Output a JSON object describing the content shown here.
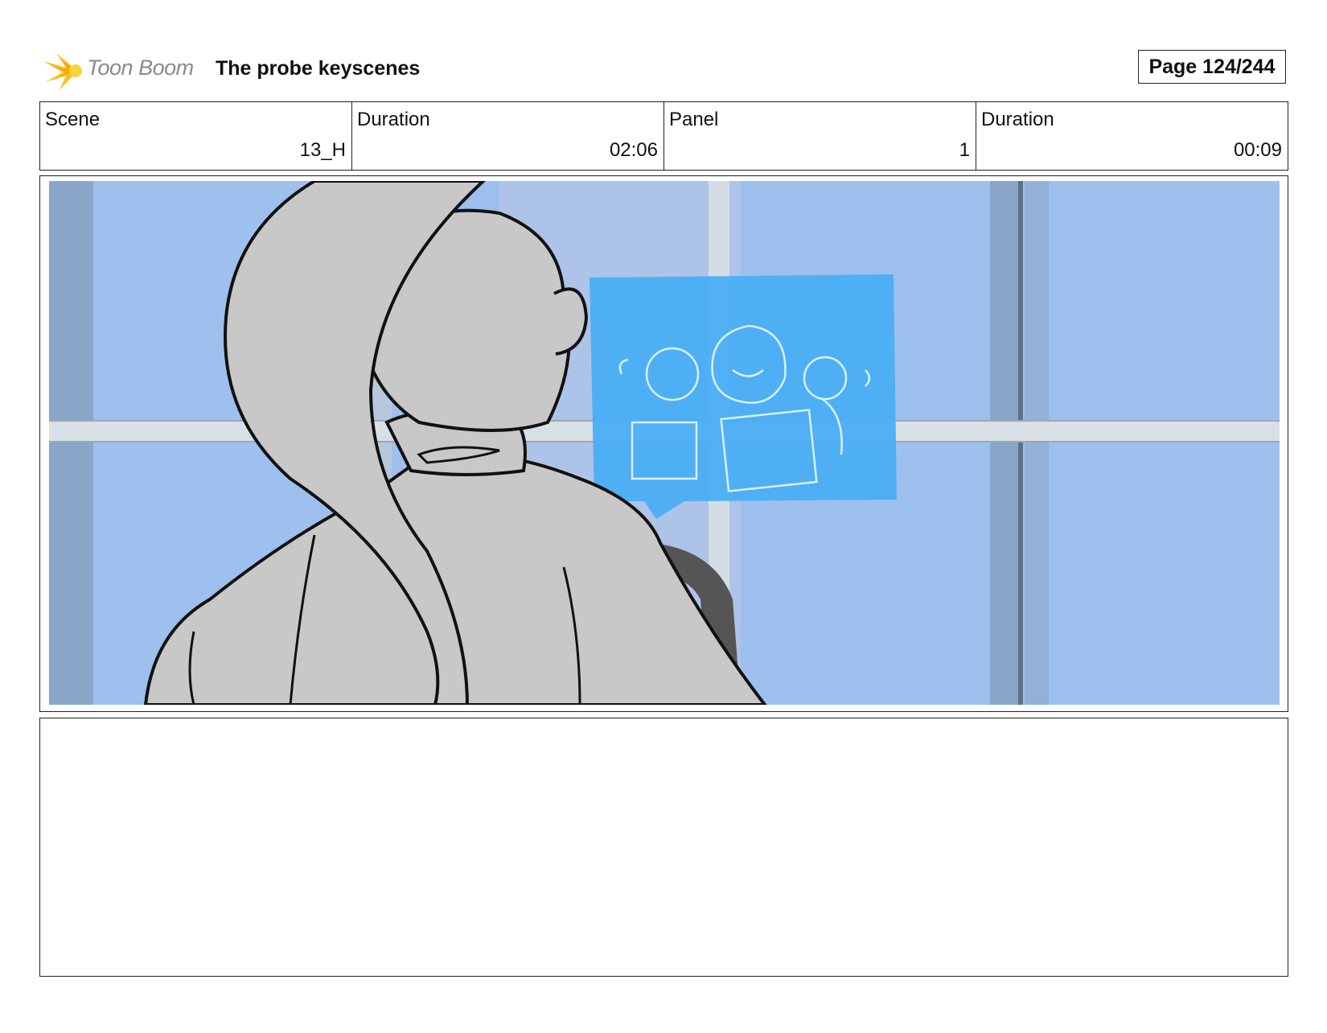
{
  "header": {
    "logo_text": "Toon Boom",
    "title": "The probe keyscenes",
    "page": "Page 124/244"
  },
  "info": {
    "scene_label": "Scene",
    "scene_value": "13_H",
    "scene_duration_label": "Duration",
    "scene_duration_value": "02:06",
    "panel_label": "Panel",
    "panel_value": "1",
    "panel_duration_label": "Duration",
    "panel_duration_value": "00:09"
  },
  "panel": {
    "sky_color": "#9dc0ee",
    "hologram_color": "#4aaef4",
    "figure_color": "#c8c8c8"
  },
  "notes": {
    "text": ""
  }
}
